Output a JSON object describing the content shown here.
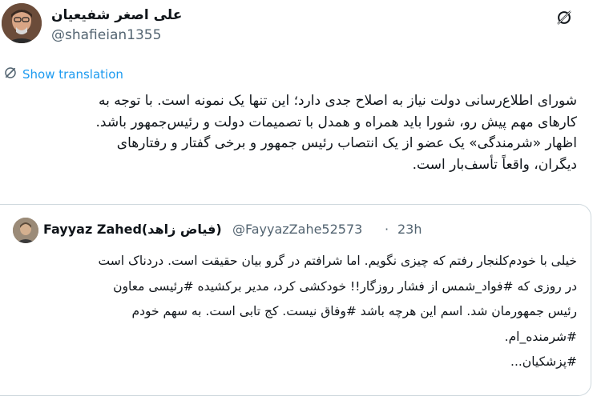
{
  "tweet": {
    "author_name": "علی اصغر شفیعیان",
    "author_handle": "@shafieian1355",
    "show_translation_label": "Show translation",
    "lines": [
      "شورای اطلاع‌رسانی دولت نیاز به اصلاح جدی دارد؛ این تنها یک نمونه است. با توجه به",
      "کارهای مهم پیش رو، شورا باید همراه و همدل با تصمیمات دولت و رئیس‌جمهور باشد.",
      "اظهار «شرمندگی» یک عضو از یک انتصاب رئیس جمهور و برخی گفتار و رفتارهای",
      "دیگران، واقعاً تأسف‌بار است."
    ]
  },
  "quoted_tweet": {
    "author_name": "Fayyaz Zahed(فیاض زاهد)",
    "author_handle": "@FayyazZahe52573",
    "separator": "·",
    "time": "23h",
    "lines": [
      "خیلی با خودم‌کلنجار رفتم که چیزی نگویم. اما شرافتم در گرو بیان حقیقت است. دردناک است",
      "در روزی که #فواد_شمس از فشار روزگار!! خودکشی کرد، مدیر برکشیده #رئیسی معاون",
      "رئیس جمهورمان شد. اسم این هرچه باشد #وفاق نیست. کج تابی است. به سهم خودم",
      "#شرمنده_ام.",
      "#پزشکیان..."
    ]
  },
  "colors": {
    "link": "#1d9bf0",
    "secondary_text": "#536471",
    "border": "#cfd9de"
  },
  "icons": {
    "grok": "grok-icon",
    "translate": "globe-icon"
  }
}
